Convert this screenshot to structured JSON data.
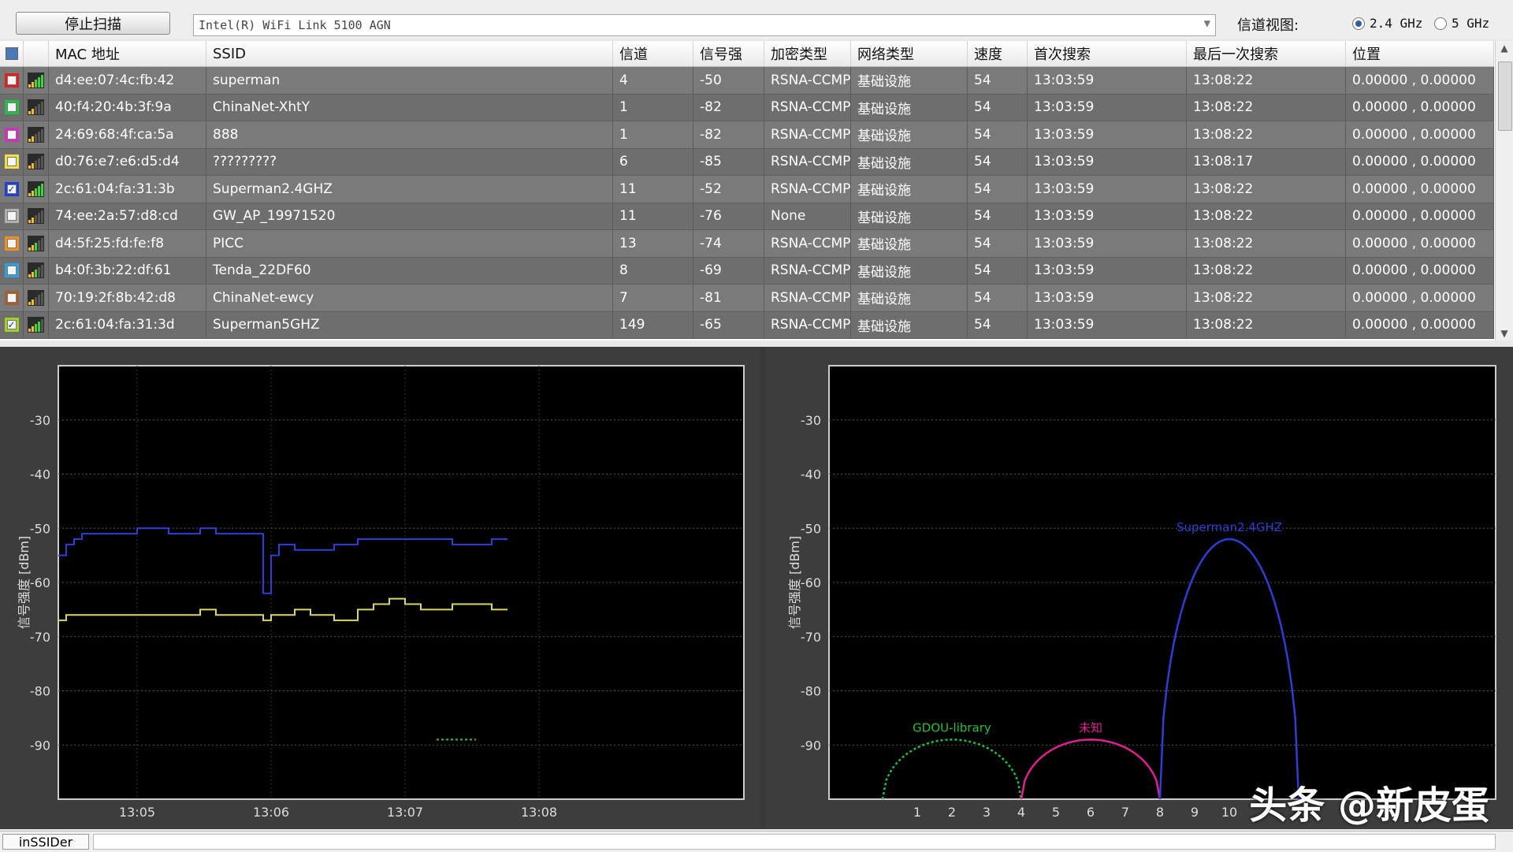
{
  "toolbar": {
    "stop_scan_label": "停止扫描",
    "adapter_value": "Intel(R) WiFi Link 5100 AGN",
    "channel_view_label": "信道视图:",
    "band_24_label": "2.4 GHz",
    "band_5_label": "5 GHz",
    "selected_band": "2.4 GHz"
  },
  "table": {
    "columns": [
      "MAC 地址",
      "SSID",
      "信道",
      "信号强",
      "加密类型",
      "网络类型",
      "速度",
      "首次搜索",
      "最后一次搜索",
      "位置"
    ],
    "rows": [
      {
        "color": "#e02020",
        "checked": false,
        "mac": "d4:ee:07:4c:fb:42",
        "ssid": "superman",
        "channel": "4",
        "rssi": "-50",
        "security": "RSNA-CCMP",
        "network": "基础设施",
        "speed": "54",
        "first": "13:03:59",
        "last": "13:08:22",
        "position": "0.00000 , 0.00000"
      },
      {
        "color": "#22c040",
        "checked": false,
        "mac": "40:f4:20:4b:3f:9a",
        "ssid": "ChinaNet-XhtY",
        "channel": "1",
        "rssi": "-82",
        "security": "RSNA-CCMP",
        "network": "基础设施",
        "speed": "54",
        "first": "13:03:59",
        "last": "13:08:22",
        "position": "0.00000 , 0.00000"
      },
      {
        "color": "#d030c0",
        "checked": false,
        "mac": "24:69:68:4f:ca:5a",
        "ssid": "888",
        "channel": "1",
        "rssi": "-82",
        "security": "RSNA-CCMP",
        "network": "基础设施",
        "speed": "54",
        "first": "13:03:59",
        "last": "13:08:22",
        "position": "0.00000 , 0.00000"
      },
      {
        "color": "#f0e040",
        "checked": false,
        "mac": "d0:76:e7:e6:d5:d4",
        "ssid": "?????????",
        "channel": "6",
        "rssi": "-85",
        "security": "RSNA-CCMP",
        "network": "基础设施",
        "speed": "54",
        "first": "13:03:59",
        "last": "13:08:17",
        "position": "0.00000 , 0.00000"
      },
      {
        "color": "#2040d0",
        "checked": true,
        "mac": "2c:61:04:fa:31:3b",
        "ssid": "Superman2.4GHZ",
        "channel": "11",
        "rssi": "-52",
        "security": "RSNA-CCMP",
        "network": "基础设施",
        "speed": "54",
        "first": "13:03:59",
        "last": "13:08:22",
        "position": "0.00000 , 0.00000"
      },
      {
        "color": "#b0b0b0",
        "checked": false,
        "mac": "74:ee:2a:57:d8:cd",
        "ssid": "GW_AP_19971520",
        "channel": "11",
        "rssi": "-76",
        "security": "None",
        "network": "基础设施",
        "speed": "54",
        "first": "13:03:59",
        "last": "13:08:22",
        "position": "0.00000 , 0.00000"
      },
      {
        "color": "#f09020",
        "checked": false,
        "mac": "d4:5f:25:fd:fe:f8",
        "ssid": "PICC",
        "channel": "13",
        "rssi": "-74",
        "security": "RSNA-CCMP",
        "network": "基础设施",
        "speed": "54",
        "first": "13:03:59",
        "last": "13:08:22",
        "position": "0.00000 , 0.00000"
      },
      {
        "color": "#30a0e0",
        "checked": false,
        "mac": "b4:0f:3b:22:df:61",
        "ssid": "Tenda_22DF60",
        "channel": "8",
        "rssi": "-69",
        "security": "RSNA-CCMP",
        "network": "基础设施",
        "speed": "54",
        "first": "13:03:59",
        "last": "13:08:22",
        "position": "0.00000 , 0.00000"
      },
      {
        "color": "#a06030",
        "checked": false,
        "mac": "70:19:2f:8b:42:d8",
        "ssid": "ChinaNet-ewcy",
        "channel": "7",
        "rssi": "-81",
        "security": "RSNA-CCMP",
        "network": "基础设施",
        "speed": "54",
        "first": "13:03:59",
        "last": "13:08:22",
        "position": "0.00000 , 0.00000"
      },
      {
        "color": "#a0d020",
        "checked": true,
        "mac": "2c:61:04:fa:31:3d",
        "ssid": "Superman5GHZ",
        "channel": "149",
        "rssi": "-65",
        "security": "RSNA-CCMP",
        "network": "基础设施",
        "speed": "54",
        "first": "13:03:59",
        "last": "13:08:22",
        "position": "0.00000 , 0.00000"
      }
    ]
  },
  "chart_data": [
    {
      "type": "line",
      "ylabel": "信号强度 [dBm]",
      "x_ticks": [
        "13:05",
        "13:06",
        "13:07",
        "13:08"
      ],
      "ylim": [
        -100,
        -20
      ],
      "y_ticks": [
        -30,
        -40,
        -50,
        -60,
        -70,
        -80,
        -90
      ],
      "grid": true,
      "series": [
        {
          "color": "#2b3fd8",
          "x": [
            0,
            1,
            2,
            3,
            6,
            10,
            14,
            18,
            20,
            25,
            26,
            27,
            28,
            30,
            35,
            38,
            40,
            42,
            44,
            46,
            50,
            55,
            57
          ],
          "y": [
            -55,
            -53,
            -52,
            -51,
            -51,
            -50,
            -51,
            -50,
            -51,
            -51,
            -62,
            -55,
            -53,
            -54,
            -53,
            -52,
            -52,
            -52,
            -52,
            -52,
            -53,
            -52,
            -52
          ]
        },
        {
          "color": "#d8d860",
          "x": [
            0,
            1,
            5,
            10,
            18,
            20,
            25,
            26,
            27,
            30,
            32,
            35,
            38,
            40,
            42,
            44,
            46,
            50,
            55,
            57
          ],
          "y": [
            -67,
            -66,
            -66,
            -66,
            -65,
            -66,
            -66,
            -67,
            -66,
            -65,
            -66,
            -67,
            -65,
            -64,
            -63,
            -64,
            -65,
            -64,
            -65,
            -65
          ]
        },
        {
          "color": "#d82020",
          "x": [
            48,
            53
          ],
          "y": [
            -89,
            -89
          ]
        },
        {
          "color": "#22c040",
          "x": [
            48,
            53
          ],
          "y": [
            -89,
            -89
          ]
        }
      ]
    },
    {
      "type": "area",
      "ylabel": "信号强度 [dBm]",
      "x_ticks": [
        "1",
        "2",
        "3",
        "4",
        "5",
        "6",
        "7",
        "8",
        "9",
        "10"
      ],
      "ylim": [
        -100,
        -20
      ],
      "y_ticks": [
        -30,
        -40,
        -50,
        -60,
        -70,
        -80,
        -90
      ],
      "grid": true,
      "networks": [
        {
          "label": "GDOU-library",
          "color": "#20c040",
          "center": 2,
          "peak": -89,
          "style": "dotted"
        },
        {
          "label": "未知",
          "color": "#e02090",
          "center": 6,
          "peak": -89,
          "style": "solid"
        },
        {
          "label": "Superman2.4GHZ",
          "color": "#2b3fd8",
          "center": 10,
          "peak": -52,
          "style": "solid"
        }
      ]
    }
  ],
  "statusbar": {
    "tab_label": "inSSIDer"
  },
  "watermark": "头条 @新皮蛋"
}
